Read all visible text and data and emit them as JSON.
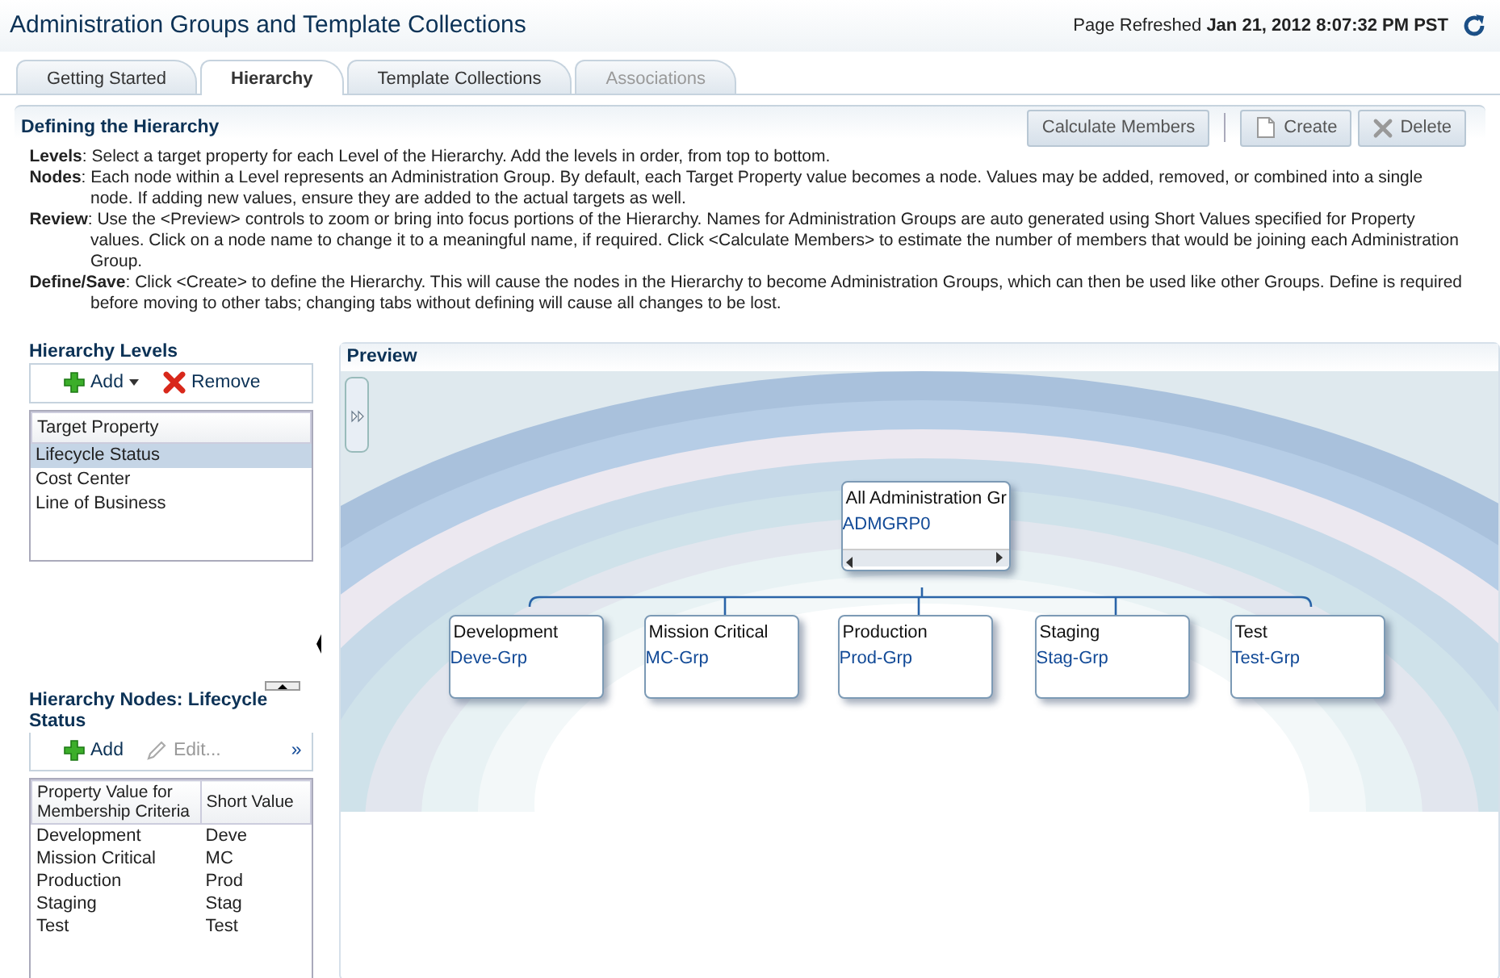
{
  "title": "Administration Groups and Template Collections",
  "refresh": {
    "label": "Page Refreshed",
    "value": "Jan 21, 2012 8:07:32 PM PST"
  },
  "tabs": [
    {
      "label": "Getting Started",
      "selected": false,
      "disabled": false
    },
    {
      "label": "Hierarchy",
      "selected": true,
      "disabled": false
    },
    {
      "label": "Template Collections",
      "selected": false,
      "disabled": false
    },
    {
      "label": "Associations",
      "selected": false,
      "disabled": true
    }
  ],
  "section": {
    "title": "Defining the Hierarchy",
    "buttons": [
      {
        "label": "Calculate Members",
        "kind": "plain"
      },
      {
        "label": "Create",
        "kind": "create"
      },
      {
        "label": "Delete",
        "kind": "delete"
      }
    ],
    "paragraphs": [
      "**Levels**: Select a target property for each Level of the Hierarchy. Add the levels in order, from top to bottom.",
      "**Nodes**: Each node within a Level represents an Administration Group. By default, each Target Property value becomes a node. Values may be added, removed, or combined into a single node. If adding new values, ensure they are added to the actual targets as well.",
      "**Review**: Use the <Preview> controls to zoom or bring into focus portions of the Hierarchy. Names for Administration Groups are auto generated using Short Values specified for Property values. Click on a node name to change it to a meaningful name, if required. Click <Calculate Members> to estimate the number of members that would be joining each Administration Group.",
      "**Define/Save**: Click <Create> to define the Hierarchy. This will cause the nodes in the Hierarchy to become Administration Groups, which can then be used like other Groups. Define is required before moving to other tabs; changing tabs without defining will cause all changes to be lost."
    ]
  },
  "levels": {
    "title": "Hierarchy Levels",
    "toolbar": [
      {
        "label": "Add",
        "kind": "add",
        "disabled": false
      },
      {
        "label": "Remove",
        "kind": "remove",
        "disabled": false
      }
    ],
    "column": "Target Property",
    "rows": [
      {
        "label": "Lifecycle Status",
        "selected": true
      },
      {
        "label": "Cost Center",
        "selected": false
      },
      {
        "label": "Line of Business",
        "selected": false
      }
    ]
  },
  "nodes": {
    "title": "Hierarchy Nodes: Lifecycle Status",
    "toolbar": [
      {
        "label": "Add",
        "kind": "add",
        "disabled": false
      },
      {
        "label": "Edit...",
        "kind": "edit",
        "disabled": true
      }
    ],
    "more": "»",
    "columns": [
      "Property Value for Membership Criteria",
      "Short Value"
    ],
    "rows": [
      [
        "Development",
        "Deve"
      ],
      [
        "Mission Critical",
        "MC"
      ],
      [
        "Production",
        "Prod"
      ],
      [
        "Staging",
        "Stag"
      ],
      [
        "Test",
        "Test"
      ]
    ]
  },
  "preview": {
    "title": "Preview",
    "root": {
      "name": "All Administration Gr",
      "group": "ADMGRP0"
    },
    "children": [
      {
        "name": "Development",
        "group": "Deve-Grp"
      },
      {
        "name": "Mission Critical",
        "group": "MC-Grp"
      },
      {
        "name": "Production",
        "group": "Prod-Grp"
      },
      {
        "name": "Staging",
        "group": "Stag-Grp"
      },
      {
        "name": "Test",
        "group": "Test-Grp"
      }
    ]
  }
}
